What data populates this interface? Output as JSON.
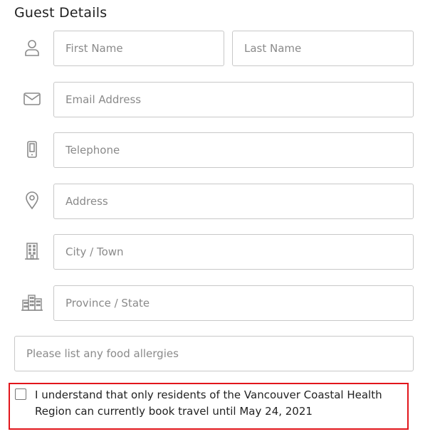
{
  "section": {
    "title": "Guest Details"
  },
  "form": {
    "first_name_placeholder": "First Name",
    "last_name_placeholder": "Last Name",
    "email_placeholder": "Email Address",
    "telephone_placeholder": "Telephone",
    "address_placeholder": "Address",
    "city_placeholder": "City / Town",
    "province_placeholder": "Province / State",
    "allergies_placeholder": "Please list any food allergies"
  },
  "consent": {
    "checked": false,
    "label": "I understand that only residents of the Vancouver Coastal Health Region can currently book travel until May 24, 2021"
  },
  "icons": {
    "name": "user-icon",
    "email": "envelope-icon",
    "telephone": "mobile-phone-icon",
    "address": "map-pin-icon",
    "city": "building-icon",
    "province": "city-buildings-icon"
  },
  "colors": {
    "highlight_border": "#e2151b",
    "input_border": "#c8c8c8",
    "icon": "#8a8a8a"
  }
}
